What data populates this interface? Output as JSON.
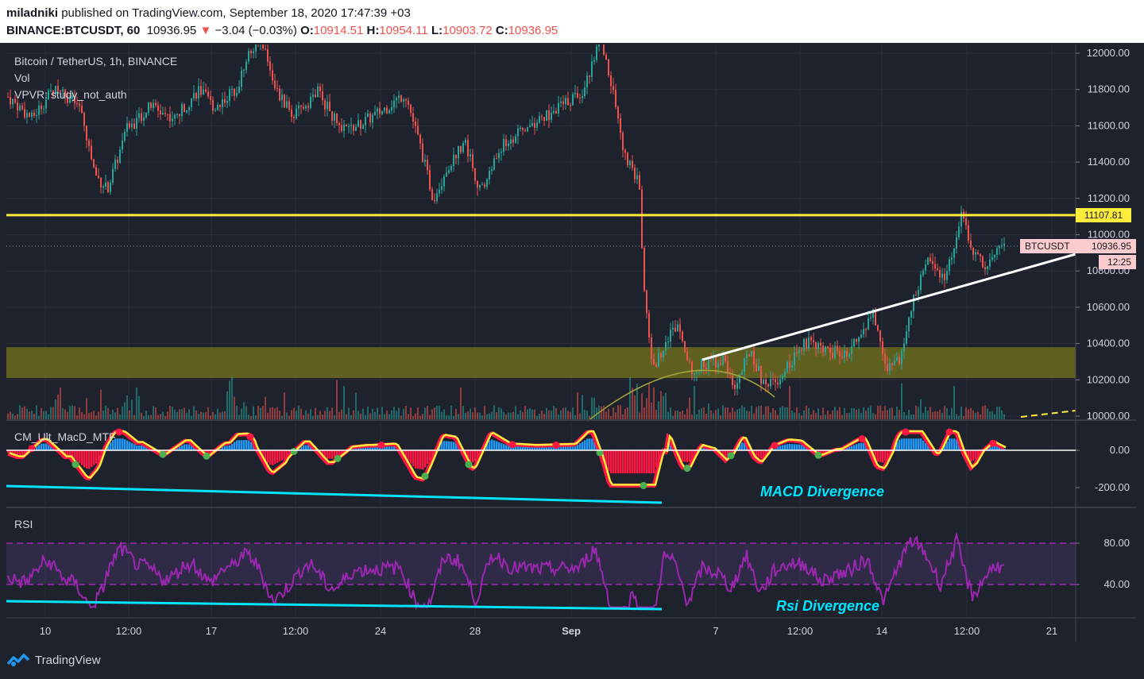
{
  "header": {
    "user": "miladniki",
    "published": " published on TradingView.com, September 18, 2020 17:47:39 +03",
    "symbol": "BINANCE:BTCUSDT, 60",
    "price": "10936.95",
    "change_arrow": "▼",
    "change": "−3.04 (−0.03%)",
    "o_label": "O:",
    "o": "10914.51",
    "h_label": "H:",
    "h": "10954.11",
    "l_label": "L:",
    "l": "10903.72",
    "c_label": "C:",
    "c": "10936.95"
  },
  "legend": {
    "main": "Bitcoin / TetherUS, 1h, BINANCE",
    "vol": "Vol",
    "vpvr": "VPVR: study_not_auth",
    "macd": "CM_Ult_MacD_MTF",
    "rsi": "RSI"
  },
  "annotations": {
    "macd_div": "MACD Divergence",
    "rsi_div": "Rsi Divergence"
  },
  "price_tags": {
    "resistance": "11107.81",
    "last_symbol": "BTCUSDT",
    "last": "10936.95",
    "countdown": "12:25"
  },
  "footer": {
    "brand": "TradingView"
  },
  "colors": {
    "bg": "#1e222d",
    "up": "#26a69a",
    "down": "#ef5350",
    "resistance": "#ffeb3b",
    "zone": "#6b6b1f",
    "rsi": "#9c27b0",
    "divergence": "#00e5ff"
  },
  "chart_data": [
    {
      "type": "candlestick",
      "title": "Bitcoin / TetherUS, 1h, BINANCE",
      "x_ticks": [
        "10",
        "12:00",
        "17",
        "12:00",
        "24",
        "28",
        "Sep",
        "7",
        "12:00",
        "14",
        "12:00",
        "21"
      ],
      "y_ticks": [
        "12000.00",
        "11800.00",
        "11600.00",
        "11400.00",
        "11200.00",
        "11000.00",
        "10800.00",
        "10600.00",
        "10400.00",
        "10200.00",
        "10000.00"
      ],
      "ylim": [
        10000,
        12100
      ],
      "horizontal_line": 11107.81,
      "support_zone": [
        10210,
        10380
      ],
      "last_price": 10936.95,
      "price_path": [
        [
          0,
          11760
        ],
        [
          30,
          11640
        ],
        [
          60,
          11820
        ],
        [
          90,
          11700
        ],
        [
          110,
          11330
        ],
        [
          125,
          11250
        ],
        [
          150,
          11580
        ],
        [
          180,
          11710
        ],
        [
          210,
          11640
        ],
        [
          240,
          11800
        ],
        [
          260,
          11700
        ],
        [
          290,
          11820
        ],
        [
          300,
          11980
        ],
        [
          320,
          12070
        ],
        [
          340,
          11770
        ],
        [
          360,
          11650
        ],
        [
          390,
          11790
        ],
        [
          420,
          11570
        ],
        [
          440,
          11600
        ],
        [
          470,
          11680
        ],
        [
          500,
          11780
        ],
        [
          520,
          11470
        ],
        [
          535,
          11200
        ],
        [
          555,
          11380
        ],
        [
          575,
          11520
        ],
        [
          595,
          11230
        ],
        [
          620,
          11480
        ],
        [
          650,
          11580
        ],
        [
          680,
          11660
        ],
        [
          700,
          11720
        ],
        [
          725,
          11800
        ],
        [
          745,
          12080
        ],
        [
          760,
          11830
        ],
        [
          775,
          11450
        ],
        [
          795,
          11270
        ],
        [
          800,
          10720
        ],
        [
          812,
          10250
        ],
        [
          828,
          10420
        ],
        [
          845,
          10520
        ],
        [
          860,
          10230
        ],
        [
          875,
          10290
        ],
        [
          900,
          10310
        ],
        [
          915,
          10160
        ],
        [
          935,
          10370
        ],
        [
          950,
          10180
        ],
        [
          970,
          10210
        ],
        [
          990,
          10330
        ],
        [
          1010,
          10430
        ],
        [
          1030,
          10350
        ],
        [
          1060,
          10360
        ],
        [
          1090,
          10560
        ],
        [
          1105,
          10270
        ],
        [
          1125,
          10330
        ],
        [
          1140,
          10640
        ],
        [
          1160,
          10870
        ],
        [
          1180,
          10760
        ],
        [
          1200,
          11110
        ],
        [
          1215,
          10900
        ],
        [
          1230,
          10840
        ],
        [
          1250,
          10950
        ],
        [
          1255,
          10937
        ]
      ]
    },
    {
      "type": "line",
      "title": "CM_Ult_MacD_MTF",
      "y_ticks": [
        "0.00",
        "-200.00"
      ],
      "ylim": [
        -300,
        150
      ]
    },
    {
      "type": "line",
      "title": "RSI",
      "y_ticks": [
        "80.00",
        "40.00"
      ],
      "ylim": [
        10,
        95
      ],
      "bands": [
        70,
        30
      ]
    }
  ]
}
